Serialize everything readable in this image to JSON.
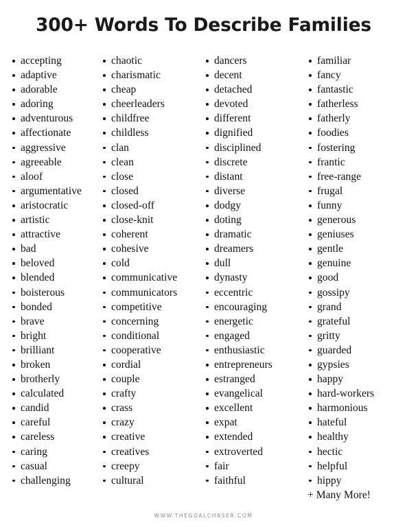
{
  "page": {
    "title": "300+ Words To Describe Families",
    "background_color": "#ffffff",
    "text_color": "#111111"
  },
  "columns": [
    {
      "name": "column-1",
      "words": [
        "accepting",
        "adaptive",
        "adorable",
        "adoring",
        "adventurous",
        "affectionate",
        "aggressive",
        "agreeable",
        "aloof",
        "argumentative",
        "aristocratic",
        "artistic",
        "attractive",
        "bad",
        "beloved",
        "blended",
        "boisterous",
        "bonded",
        "brave",
        "bright",
        "brilliant",
        "broken",
        "brotherly",
        "calculated",
        "candid",
        "careful",
        "careless",
        "caring",
        "casual",
        "challenging"
      ]
    },
    {
      "name": "column-2",
      "words": [
        "chaotic",
        "charismatic",
        "cheap",
        "cheerleaders",
        "childfree",
        "childless",
        "clan",
        "clean",
        "close",
        "closed",
        "closed-off",
        "close-knit",
        "coherent",
        "cohesive",
        "cold",
        "communicative",
        "communicators",
        "competitive",
        "concerning",
        "conditional",
        "cooperative",
        "cordial",
        "couple",
        "crafty",
        "crass",
        "crazy",
        "creative",
        "creatives",
        "creepy",
        "cultural"
      ]
    },
    {
      "name": "column-3",
      "words": [
        "dancers",
        "decent",
        "detached",
        "devoted",
        "different",
        "dignified",
        "disciplined",
        "discrete",
        "distant",
        "diverse",
        "dodgy",
        "doting",
        "dramatic",
        "dreamers",
        "dull",
        "dynasty",
        "eccentric",
        "encouraging",
        "energetic",
        "engaged",
        "enthusiastic",
        "entrepreneurs",
        "estranged",
        "evangelical",
        "excellent",
        "expat",
        "extended",
        "extroverted",
        "fair",
        "faithful"
      ]
    },
    {
      "name": "column-4",
      "words": [
        "familiar",
        "fancy",
        "fantastic",
        "fatherless",
        "fatherly",
        "foodies",
        "fostering",
        "frantic",
        "free-range",
        "frugal",
        "funny",
        "generous",
        "geniuses",
        "gentle",
        "genuine",
        "good",
        "gossipy",
        "grand",
        "grateful",
        "gritty",
        "guarded",
        "gypsies",
        "happy",
        "hard-workers",
        "harmonious",
        "hateful",
        "healthy",
        "hectic",
        "helpful",
        "hippy"
      ],
      "trailing_note": "+ Many More!"
    }
  ],
  "footer": {
    "url": "WWW.THEGOALCHASER.COM",
    "color": "#8a8a8a"
  }
}
